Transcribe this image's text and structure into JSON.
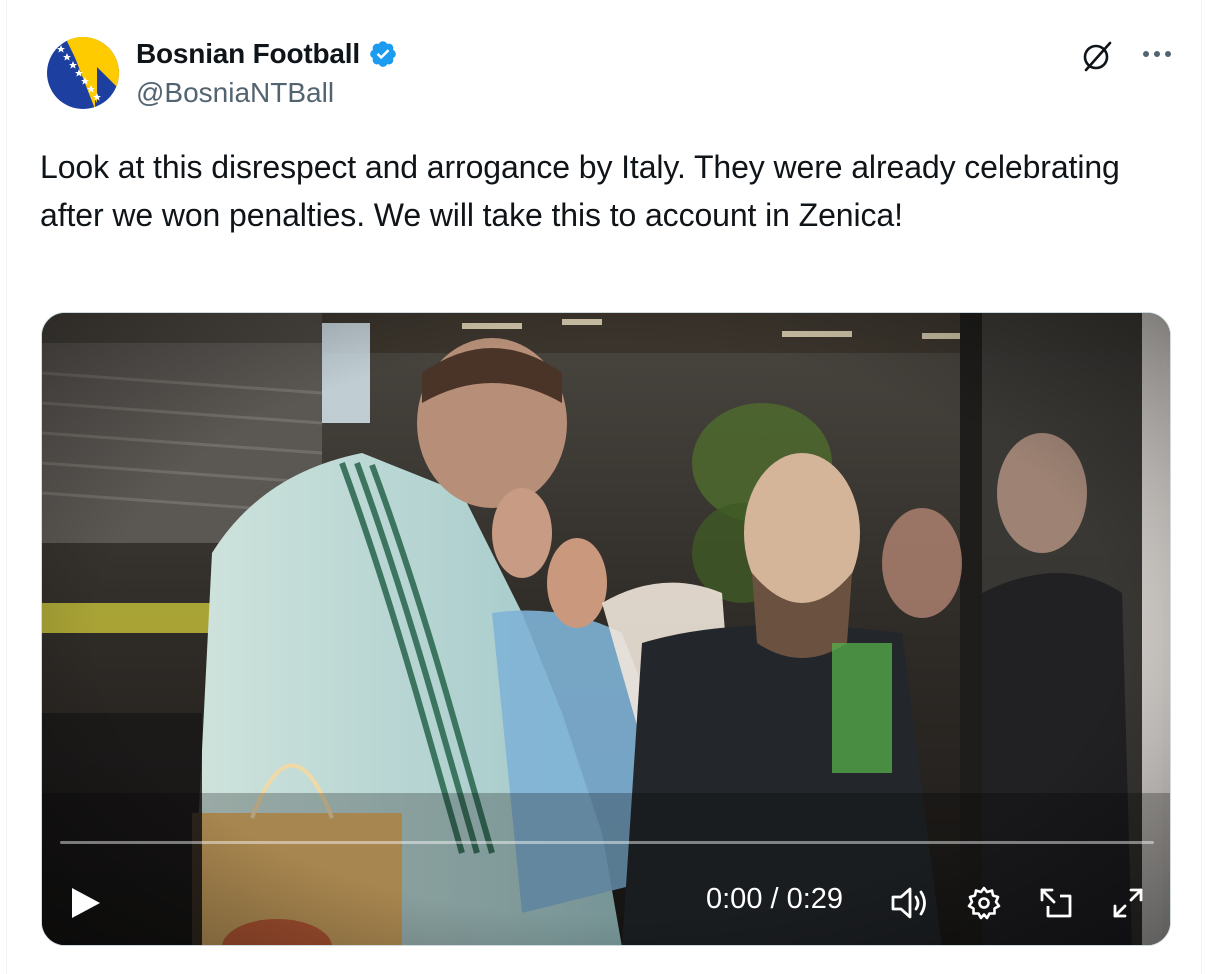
{
  "author": {
    "display_name": "Bosnian Football",
    "handle": "@BosniaNTBall",
    "verified": true,
    "avatar_icon": "bosnia-flag-avatar"
  },
  "actions": {
    "grok_icon": "grok-icon",
    "more_icon": "more-options-icon"
  },
  "tweet": {
    "text": "Look at this disrespect and arrogance by Italy. They were already celebrating after we won penalties. We will take this to account in Zenica!"
  },
  "video": {
    "time_display": "0:00 / 0:29",
    "progress": 0,
    "controls": [
      "play-icon",
      "volume-icon",
      "settings-icon",
      "picture-in-picture-icon",
      "fullscreen-icon"
    ]
  },
  "colors": {
    "accent": "#1d9bf0",
    "text_primary": "#0f1419",
    "text_secondary": "#536471",
    "flag_blue": "#002395",
    "flag_yellow": "#FECB00"
  }
}
